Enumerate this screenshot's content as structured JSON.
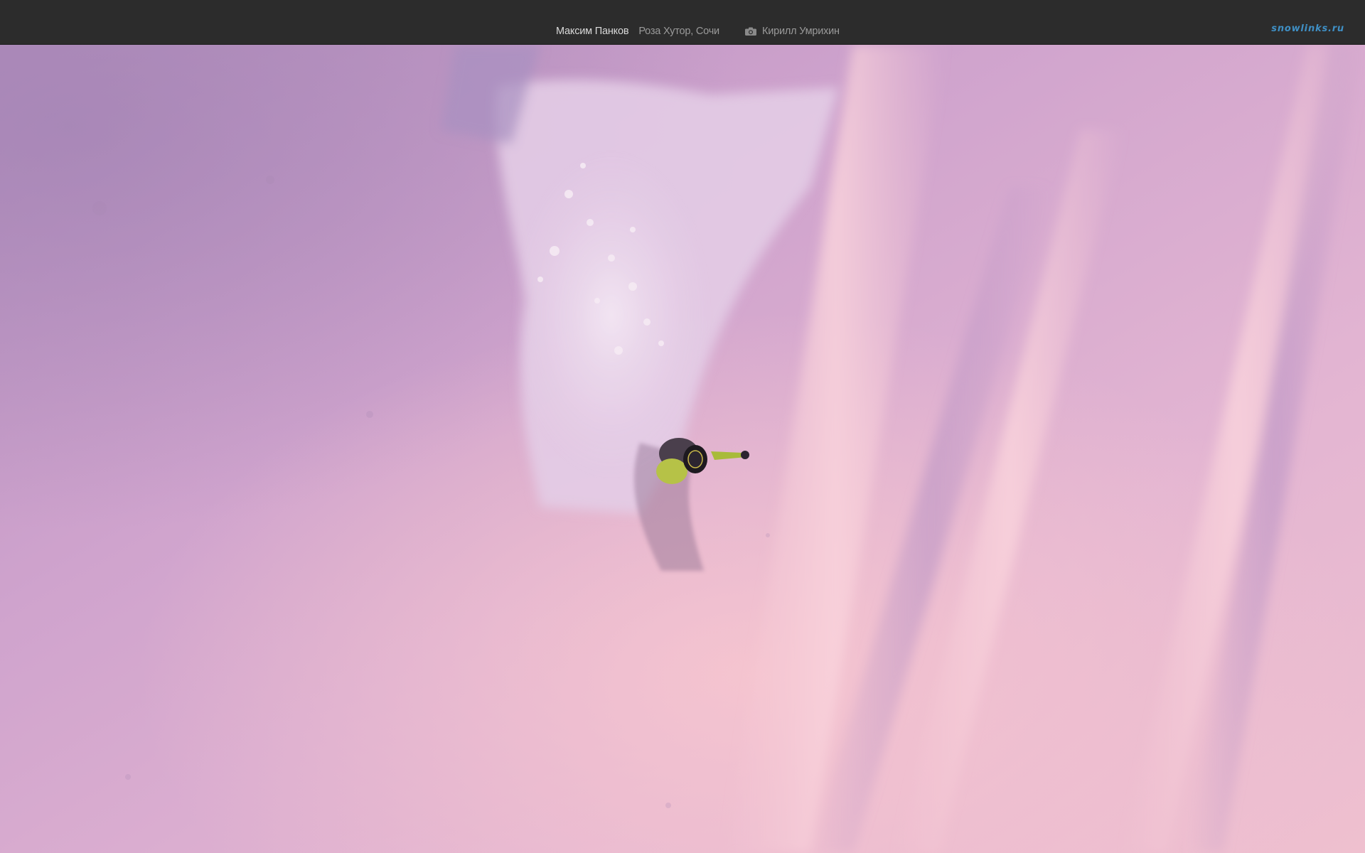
{
  "header": {
    "rider_name": "Максим Панков",
    "location": "Роза Хутор, Сочи",
    "photographer_icon": "camera-icon",
    "photographer": "Кирилл Умрихин",
    "logo_text": "snowlinks.ru"
  },
  "colors": {
    "topbar_bg": "#2c2c2c",
    "logo": "#3f8fc4",
    "snow_base": "#d8a8cc"
  }
}
